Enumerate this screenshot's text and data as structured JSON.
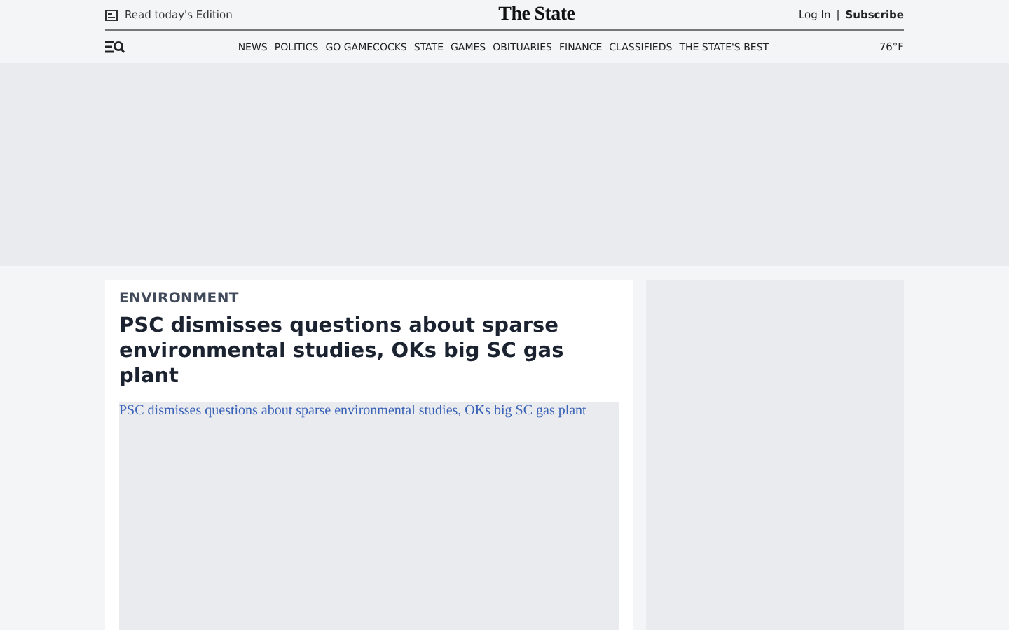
{
  "top_bar": {
    "edition_link": "Read today's Edition",
    "logo": "The State",
    "login": "Log In",
    "separator": "|",
    "subscribe": "Subscribe"
  },
  "nav": {
    "items": [
      "NEWS",
      "POLITICS",
      "GO GAMECOCKS",
      "STATE",
      "GAMES",
      "OBITUARIES",
      "FINANCE",
      "CLASSIFIEDS",
      "THE STATE'S BEST"
    ],
    "weather": "76°F"
  },
  "article": {
    "section": "ENVIRONMENT",
    "headline": "PSC dismisses questions about sparse environmental studies, OKs big SC gas plant",
    "image_alt": "PSC dismisses questions about sparse environmental studies, OKs big SC gas plant"
  }
}
